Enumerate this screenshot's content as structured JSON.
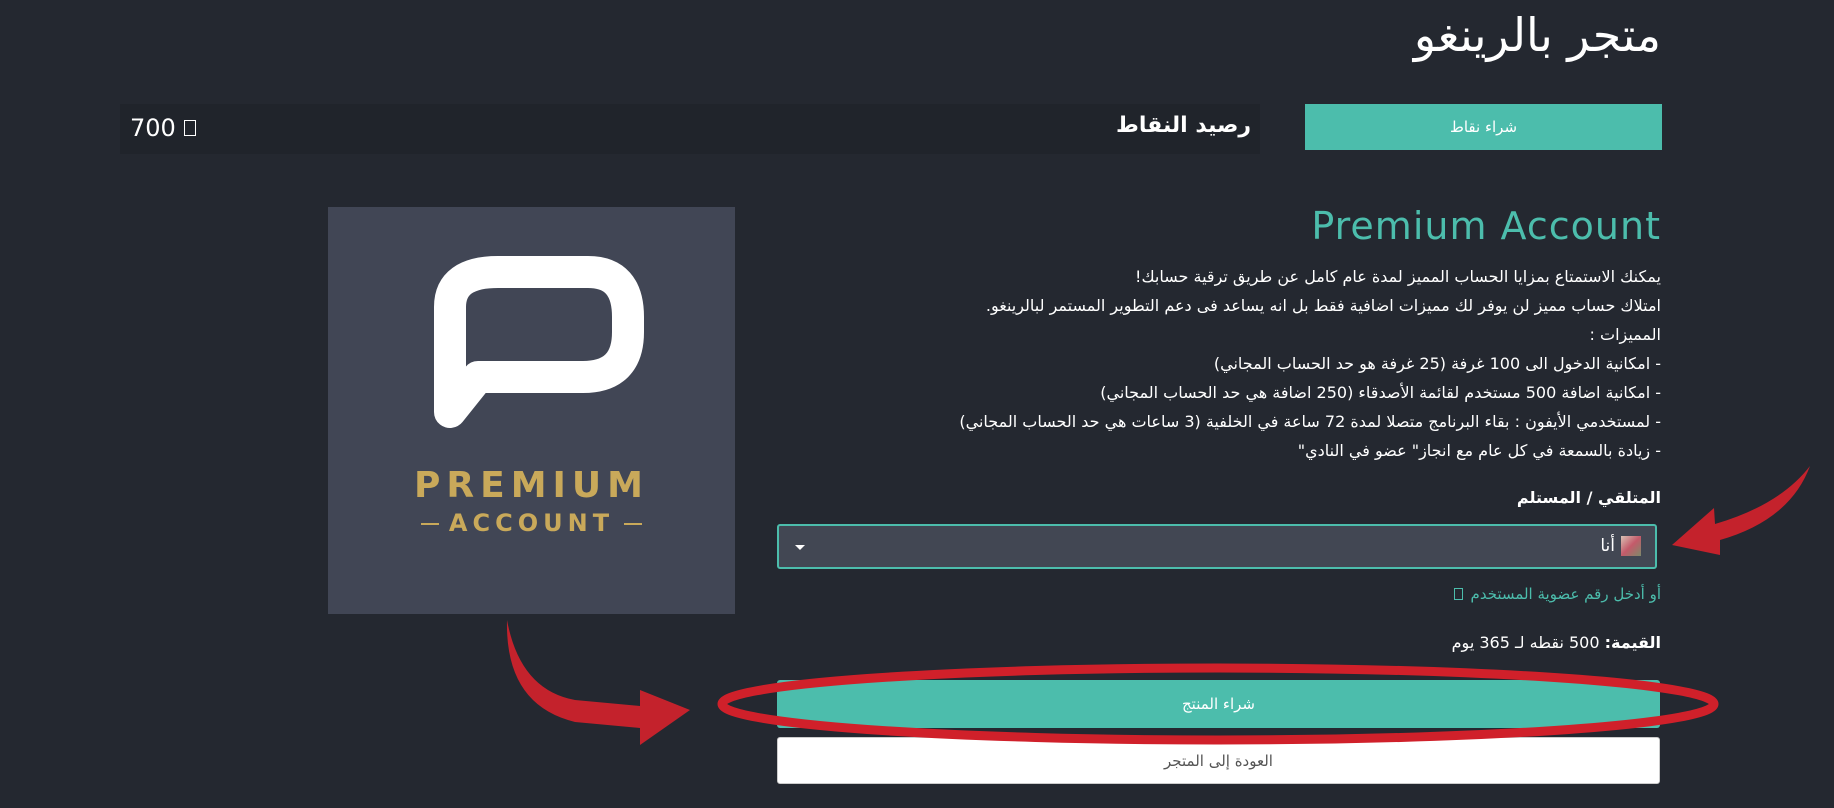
{
  "header": {
    "store_title": "متجر بالرينغو",
    "points_balance_label": "رصيد النقاط",
    "points_balance_value": "700",
    "buy_points_label": "شراء نقاط"
  },
  "product": {
    "title": "Premium Account",
    "image_text_top": "PREMIUM",
    "image_text_bottom": "ACCOUNT",
    "description": [
      "يمكنك الاستمتاع بمزايا الحساب المميز لمدة عام كامل عن طريق ترقية حسابك!",
      "امتلاك حساب مميز لن يوفر لك مميزات اضافية فقط بل انه يساعد فى دعم التطوير المستمر لبالرينغو.",
      "المميزات :",
      "- امكانية الدخول الى 100 غرفة (25 غرفة هو حد الحساب المجاني)",
      "- امكانية اضافة 500 مستخدم لقائمة الأصدقاء (250 اضافة هي حد الحساب المجاني)",
      "- لمستخدمي الأيفون : بقاء البرنامج متصلا لمدة 72 ساعة في الخلفية (3 ساعات هي حد الحساب المجاني)",
      "- زيادة بالسمعة في كل عام مع انجاز\" عضو في النادي\""
    ]
  },
  "recipient": {
    "label": "المتلقي / المستلم",
    "selected_value": "أنا",
    "member_link": "أو أدخل رقم عضوية المستخدم"
  },
  "price": {
    "label": "القيمة:",
    "value": "500 نقطه لـ 365 يوم"
  },
  "actions": {
    "buy_product": "شراء المنتج",
    "back_to_store": "العودة إلى المتجر"
  },
  "colors": {
    "background": "#242830",
    "accent": "#4cbdac",
    "annotation": "#d0202a",
    "gold": "#c9a95a"
  },
  "icons": {
    "balance": "coin-icon",
    "member_link": "external-link-icon",
    "select": "chevron-down-icon"
  }
}
